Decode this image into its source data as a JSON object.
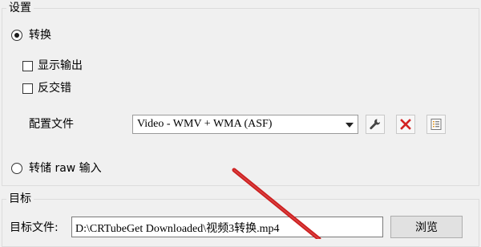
{
  "settings": {
    "group_title": "设置",
    "convert_label": "转换",
    "show_output_label": "显示输出",
    "deinterlace_label": "反交错",
    "profile_label": "配置文件",
    "profile_value": "Video - WMV + WMA (ASF)",
    "dump_raw_label": "转储 raw 输入",
    "convert_selected": true,
    "show_output_checked": false,
    "deinterlace_checked": false,
    "dump_raw_selected": false
  },
  "profile_buttons": {
    "edit_icon": "wrench-icon",
    "delete_icon": "red-x-icon",
    "new_icon": "list-document-icon"
  },
  "target": {
    "group_title": "目标",
    "file_label": "目标文件:",
    "file_value": "D:\\CRTubeGet Downloaded\\视频3转换.mp4",
    "browse_label": "浏览"
  },
  "colors": {
    "delete_red": "#d32222",
    "arrow_red": "#cc1f1f"
  }
}
